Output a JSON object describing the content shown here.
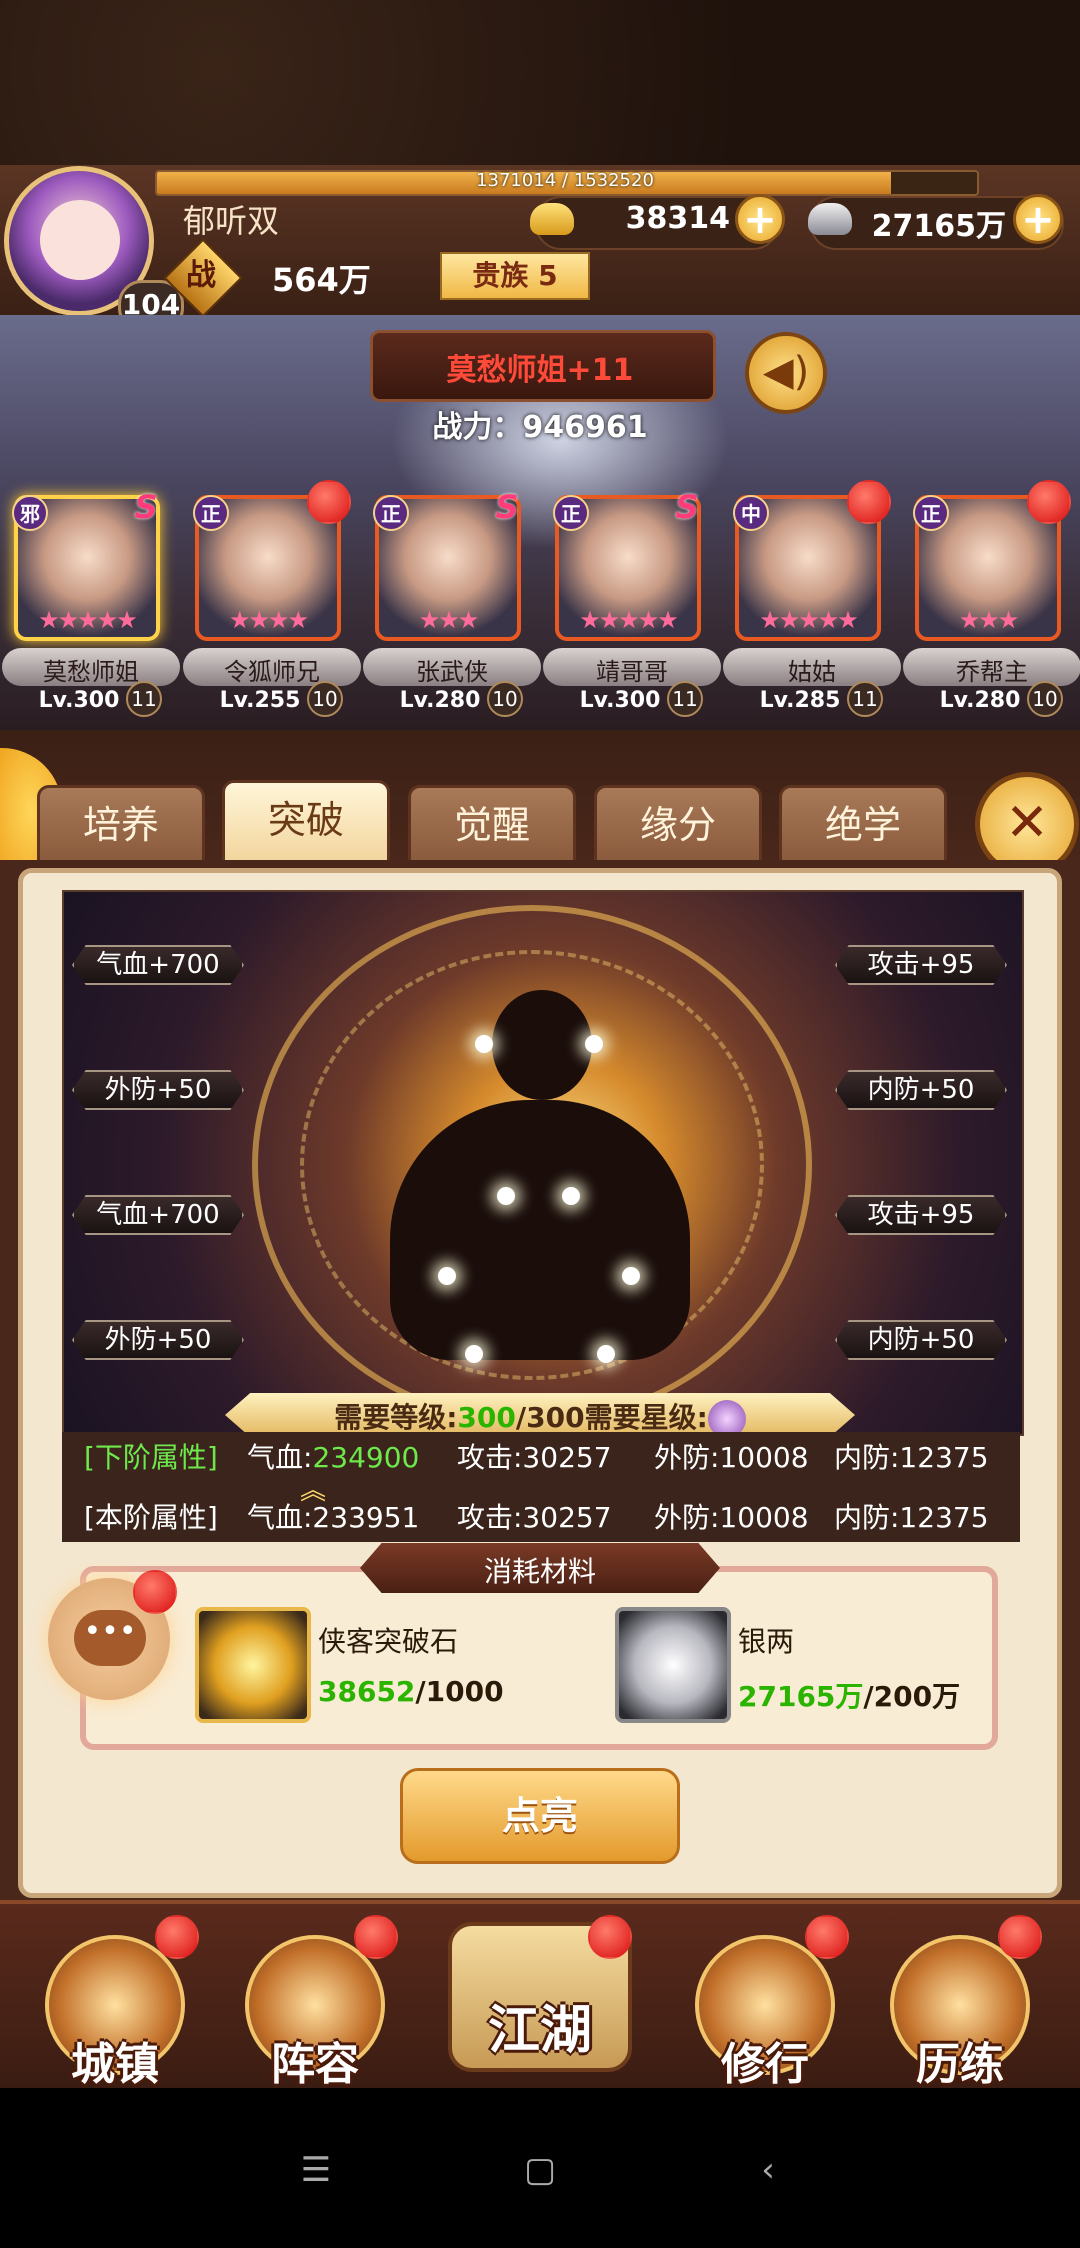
{
  "player": {
    "name": "郁听双",
    "level": "104",
    "exp_text": "1371014 / 1532520",
    "exp_fraction": 0.895,
    "power_char": "战",
    "power": "564万",
    "vip": "贵族 5",
    "gold": "38314",
    "silver": "27165万"
  },
  "hero": {
    "title": "莫愁师姐+11",
    "power": "战力：946961"
  },
  "heroes": [
    {
      "name": "莫愁师姐",
      "level": "Lv.300",
      "badge": "11",
      "faction": "邪",
      "stars": "★★★★★",
      "mark": "S"
    },
    {
      "name": "令狐师兄",
      "level": "Lv.255",
      "badge": "10",
      "faction": "正",
      "stars": "★★★★",
      "mark": ""
    },
    {
      "name": "张武侠",
      "level": "Lv.280",
      "badge": "10",
      "faction": "正",
      "stars": "★★★",
      "mark": "S"
    },
    {
      "name": "靖哥哥",
      "level": "Lv.300",
      "badge": "11",
      "faction": "正",
      "stars": "★★★★★",
      "mark": "S"
    },
    {
      "name": "姑姑",
      "level": "Lv.285",
      "badge": "11",
      "faction": "中",
      "stars": "★★★★★",
      "mark": ""
    },
    {
      "name": "乔帮主",
      "level": "Lv.280",
      "badge": "10",
      "faction": "正",
      "stars": "★★★",
      "mark": ""
    }
  ],
  "tabs": [
    "培养",
    "突破",
    "觉醒",
    "缘分",
    "绝学"
  ],
  "active_tab": "突破",
  "breakthrough": {
    "left_attrs": [
      "气血+700",
      "外防+50",
      "气血+700",
      "外防+50"
    ],
    "right_attrs": [
      "攻击+95",
      "内防+50",
      "攻击+95",
      "内防+50"
    ],
    "req_level_label": "需要等级:",
    "req_level_current": "300",
    "req_level_max": "/300",
    "req_star_label": "需要星级:"
  },
  "attributes": {
    "next": {
      "label": "[下阶属性]",
      "hp": "气血:",
      "hp_val": "234900",
      "atk": "攻击:30257",
      "outer_def": "外防:10008",
      "inner_def": "内防:12375"
    },
    "current": {
      "label": "[本阶属性]",
      "hp": "气血:233951",
      "atk": "攻击:30257",
      "outer_def": "外防:10008",
      "inner_def": "内防:12375"
    }
  },
  "materials": {
    "title": "消耗材料",
    "items": [
      {
        "name": "侠客突破石",
        "have": "38652",
        "need": "/1000"
      },
      {
        "name": "银两",
        "have": "27165万",
        "need": "/200万"
      }
    ]
  },
  "actions": {
    "light_up": "点亮"
  },
  "nav": [
    "城镇",
    "阵容",
    "江湖",
    "修行",
    "历练"
  ],
  "icons": {
    "sound": "speaker-icon",
    "close": "close-icon",
    "chat": "chat-icon"
  },
  "colors": {
    "accent": "#f0b14a",
    "alert": "#d80f0f",
    "green": "#2ab400"
  }
}
